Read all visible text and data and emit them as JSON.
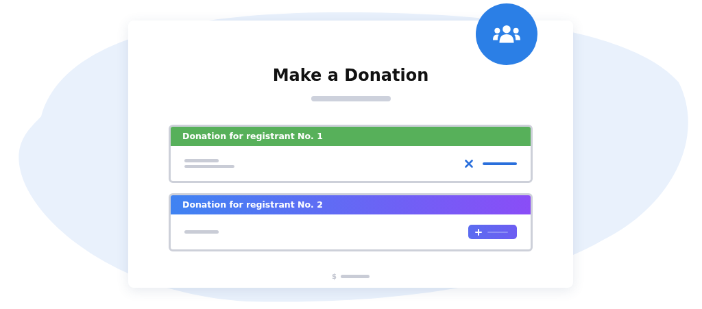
{
  "title": "Make a Donation",
  "currency": "$",
  "registrants": [
    {
      "heading": "Donation for registrant No. 1",
      "kind": "remove"
    },
    {
      "heading": "Donation for registrant No. 2",
      "kind": "add"
    }
  ]
}
